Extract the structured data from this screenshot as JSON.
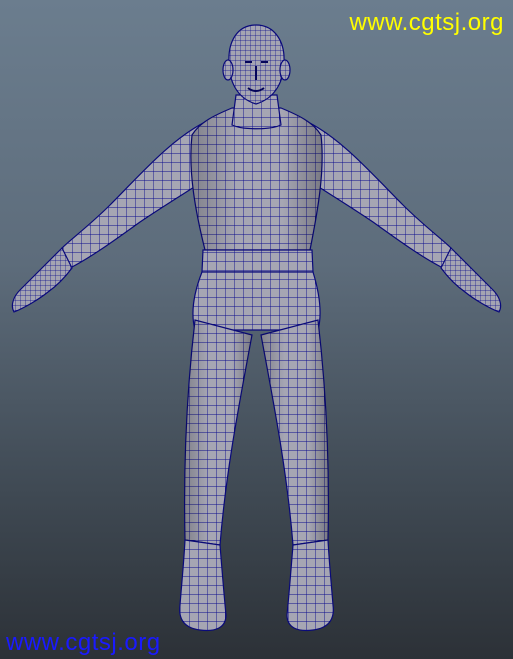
{
  "watermarks": {
    "top": "www.cgtsj.org",
    "bottom": "www.cgtsj.org",
    "top_color": "#ffff00",
    "bottom_color": "#1a1aff"
  },
  "viewport": {
    "background_top": "#6b7d8e",
    "background_bottom": "#2c3137",
    "model": "character-wireframe-icon",
    "mesh_fill": "#a8a8b4",
    "wire_color": "#0a0a8c",
    "display_mode": "smooth shaded with wireframe"
  }
}
